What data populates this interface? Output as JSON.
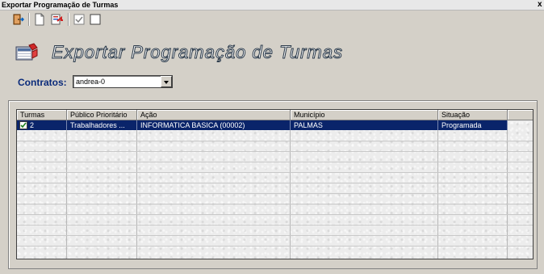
{
  "window": {
    "title": "Exportar Programação de Turmas",
    "close_label": "x"
  },
  "toolbar": {
    "items": [
      {
        "icon": "exit-door-icon"
      },
      {
        "icon": "new-document-icon"
      },
      {
        "icon": "export-document-icon"
      },
      {
        "icon": "check-all-icon"
      },
      {
        "icon": "uncheck-all-icon"
      }
    ]
  },
  "header": {
    "title": "Exportar Programação de Turmas",
    "icon": "export-grid-icon"
  },
  "contratos": {
    "label": "Contratos:",
    "value": "andrea-0"
  },
  "grid": {
    "columns": [
      "Turmas",
      "Público Prioritário",
      "Ação",
      "Município",
      "Situação"
    ],
    "rows": [
      {
        "checked": true,
        "turmas": "2",
        "publico": "Trabalhadores ...",
        "acao": "INFORMATICA BASICA (00002)",
        "municipio": "PALMAS",
        "situacao": "Programada"
      }
    ]
  },
  "colors": {
    "selection": "#0a246a",
    "label_blue": "#0a2a7a",
    "window_bg": "#d4d0c8"
  }
}
